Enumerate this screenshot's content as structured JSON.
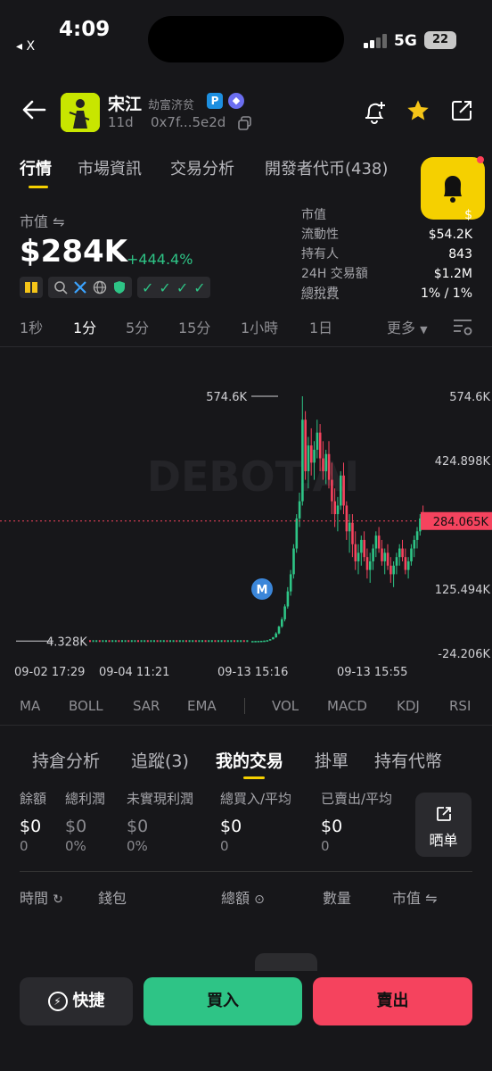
{
  "status_bar": {
    "time": "4:09",
    "back_app": "◂ X",
    "network": "5G",
    "battery": "22"
  },
  "token": {
    "name": "宋江",
    "subtitle": "劫富济贫",
    "age": "11d",
    "address": "0x7f...5e2d"
  },
  "tabs": [
    "行情",
    "市場資訊",
    "交易分析",
    "開發者代币(438)"
  ],
  "market": {
    "label": "市值 ⇋",
    "value": "$284K",
    "change": "+444.4%"
  },
  "stats": [
    {
      "key": "市值",
      "value": "$"
    },
    {
      "key": "流動性",
      "value": "$54.2K"
    },
    {
      "key": "持有人",
      "value": "843"
    },
    {
      "key": "24H 交易額",
      "value": "$1.2M"
    },
    {
      "key": "總稅費",
      "value": "1% / 1%"
    }
  ],
  "timeframes": [
    "1秒",
    "1分",
    "5分",
    "15分",
    "1小時",
    "1日"
  ],
  "timeframe_selected": "1分",
  "more_label": "更多",
  "chart_data": {
    "type": "candlestick",
    "watermark": "DEBOT.AI",
    "y_ticks": [
      "574.6K",
      "424.898K",
      "125.494K",
      "-24.206K"
    ],
    "current_price_label": "284.065K",
    "high_label": "574.6K",
    "low_label": "4.328K",
    "x_ticks": [
      "09-02 17:29",
      "09-04 11:21",
      "09-13 15:16",
      "09-13 15:55"
    ],
    "marker": "M",
    "colors": {
      "up": "#2ec486",
      "down": "#f5435e"
    },
    "ylim": [
      -24.206,
      574.6
    ],
    "candles": [
      [
        4.3,
        4.4,
        4.2,
        4.3
      ],
      [
        4.3,
        4.6,
        4.2,
        4.5
      ],
      [
        4.5,
        4.8,
        4.4,
        4.6
      ],
      [
        4.6,
        5.0,
        4.5,
        4.9
      ],
      [
        4.9,
        5.5,
        4.8,
        5.3
      ],
      [
        5.3,
        6.5,
        5.0,
        6.2
      ],
      [
        6.2,
        9.0,
        6.0,
        8.5
      ],
      [
        8.5,
        14,
        8,
        13
      ],
      [
        13,
        25,
        12,
        22
      ],
      [
        22,
        40,
        20,
        38
      ],
      [
        38,
        60,
        35,
        55
      ],
      [
        55,
        90,
        50,
        85
      ],
      [
        85,
        130,
        80,
        120
      ],
      [
        120,
        170,
        110,
        160
      ],
      [
        160,
        230,
        150,
        220
      ],
      [
        220,
        300,
        210,
        290
      ],
      [
        290,
        350,
        270,
        330
      ],
      [
        330,
        574.6,
        320,
        520
      ],
      [
        520,
        540,
        380,
        400
      ],
      [
        400,
        480,
        360,
        460
      ],
      [
        460,
        500,
        390,
        420
      ],
      [
        420,
        470,
        380,
        450
      ],
      [
        450,
        520,
        430,
        490
      ],
      [
        490,
        510,
        400,
        430
      ],
      [
        430,
        470,
        380,
        400
      ],
      [
        400,
        450,
        370,
        440
      ],
      [
        440,
        470,
        360,
        380
      ],
      [
        380,
        420,
        300,
        330
      ],
      [
        330,
        360,
        270,
        300
      ],
      [
        300,
        340,
        260,
        320
      ],
      [
        320,
        400,
        310,
        390
      ],
      [
        390,
        420,
        300,
        320
      ],
      [
        320,
        330,
        240,
        260
      ],
      [
        260,
        300,
        210,
        280
      ],
      [
        280,
        300,
        200,
        230
      ],
      [
        230,
        260,
        170,
        190
      ],
      [
        190,
        230,
        160,
        210
      ],
      [
        210,
        250,
        180,
        240
      ],
      [
        240,
        260,
        190,
        200
      ],
      [
        200,
        220,
        150,
        170
      ],
      [
        170,
        210,
        140,
        190
      ],
      [
        190,
        230,
        170,
        220
      ],
      [
        220,
        260,
        200,
        250
      ],
      [
        250,
        270,
        210,
        220
      ],
      [
        220,
        240,
        180,
        190
      ],
      [
        190,
        220,
        160,
        210
      ],
      [
        210,
        230,
        170,
        180
      ],
      [
        180,
        200,
        140,
        160
      ],
      [
        160,
        190,
        130,
        180
      ],
      [
        180,
        210,
        160,
        200
      ],
      [
        200,
        230,
        180,
        220
      ],
      [
        220,
        240,
        190,
        200
      ],
      [
        200,
        220,
        160,
        170
      ],
      [
        170,
        200,
        150,
        190
      ],
      [
        190,
        230,
        180,
        220
      ],
      [
        220,
        250,
        200,
        240
      ],
      [
        240,
        270,
        220,
        260
      ],
      [
        260,
        300,
        250,
        290
      ],
      [
        290,
        320,
        270,
        284
      ]
    ]
  },
  "indicators": [
    "MA",
    "BOLL",
    "SAR",
    "EMA",
    "VOL",
    "MACD",
    "KDJ",
    "RSI"
  ],
  "section_tabs": [
    "持倉分析",
    "追蹤(3)",
    "我的交易",
    "掛單",
    "持有代幣"
  ],
  "section_selected": "我的交易",
  "summary": [
    {
      "header": "餘額",
      "value": "$0",
      "sub": "0"
    },
    {
      "header": "總利潤",
      "value": "$0",
      "sub": "0%"
    },
    {
      "header": "未實現利潤",
      "value": "$0",
      "sub": "0%"
    },
    {
      "header": "總買入/平均",
      "value": "$0",
      "sub": "0"
    },
    {
      "header": "已賣出/平均",
      "value": "$0",
      "sub": "0"
    }
  ],
  "share_label": "晒单",
  "table_headers": [
    "時間",
    "錢包",
    "總額",
    "數量",
    "市值 ⇋"
  ],
  "actions": {
    "quick": "快捷",
    "buy": "買入",
    "sell": "賣出"
  }
}
